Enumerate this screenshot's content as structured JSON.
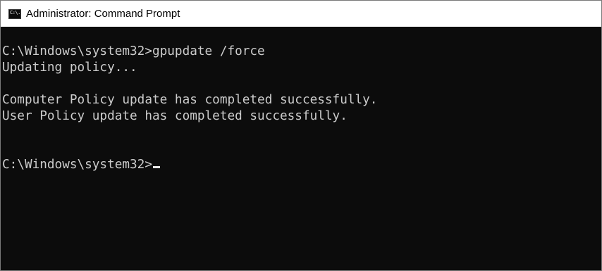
{
  "window": {
    "title": "Administrator: Command Prompt",
    "icon_text": "C:\\."
  },
  "console": {
    "lines": [
      "C:\\Windows\\system32>gpupdate /force",
      "Updating policy...",
      "",
      "Computer Policy update has completed successfully.",
      "User Policy update has completed successfully.",
      "",
      "",
      "C:\\Windows\\system32>"
    ]
  },
  "colors": {
    "background": "#0c0c0c",
    "text": "#cccccc",
    "titlebar": "#ffffff"
  },
  "icons": {
    "app": "command-prompt-icon"
  }
}
